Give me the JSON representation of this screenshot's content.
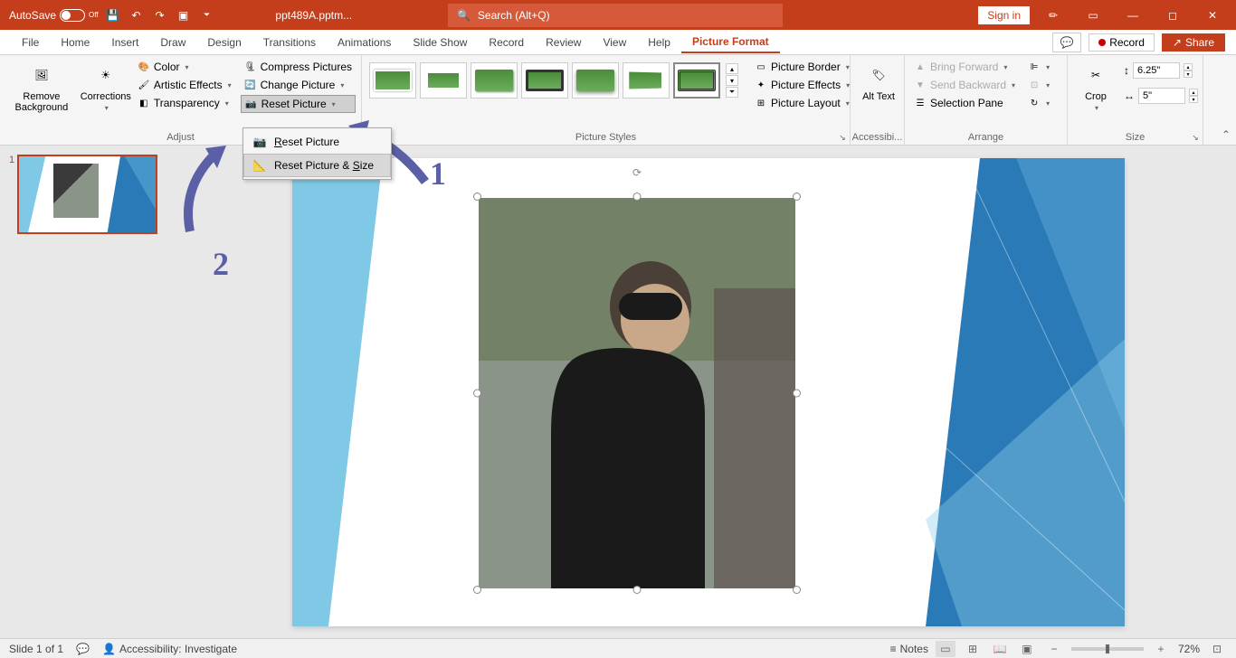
{
  "titlebar": {
    "autosave_label": "AutoSave",
    "autosave_state": "Off",
    "filename": "ppt489A.pptm...",
    "search_placeholder": "Search (Alt+Q)",
    "signin": "Sign in"
  },
  "tabs": {
    "items": [
      "File",
      "Home",
      "Insert",
      "Draw",
      "Design",
      "Transitions",
      "Animations",
      "Slide Show",
      "Record",
      "Review",
      "View",
      "Help",
      "Picture Format"
    ],
    "active": "Picture Format",
    "record": "Record",
    "share": "Share"
  },
  "ribbon": {
    "adjust": {
      "label": "Adjust",
      "remove_bg": "Remove Background",
      "corrections": "Corrections",
      "color": "Color",
      "artistic": "Artistic Effects",
      "transparency": "Transparency",
      "compress": "Compress Pictures",
      "change": "Change Picture",
      "reset": "Reset Picture"
    },
    "styles": {
      "label": "Picture Styles",
      "border": "Picture Border",
      "effects": "Picture Effects",
      "layout": "Picture Layout"
    },
    "accessibility": {
      "label": "Accessibi...",
      "alt_text": "Alt Text"
    },
    "arrange": {
      "label": "Arrange",
      "bring_forward": "Bring Forward",
      "send_backward": "Send Backward",
      "selection_pane": "Selection Pane"
    },
    "size": {
      "label": "Size",
      "crop": "Crop",
      "height": "6.25\"",
      "width": "5\""
    }
  },
  "dropdown": {
    "reset_picture": "Reset Picture",
    "reset_picture_size": "Reset Picture & Size",
    "reset_r": "R",
    "reset_s": "S"
  },
  "annotation": {
    "one": "1",
    "two": "2"
  },
  "statusbar": {
    "slide": "Slide 1 of 1",
    "accessibility": "Accessibility: Investigate",
    "notes": "Notes",
    "zoom": "72%"
  },
  "thumb": {
    "num": "1"
  }
}
